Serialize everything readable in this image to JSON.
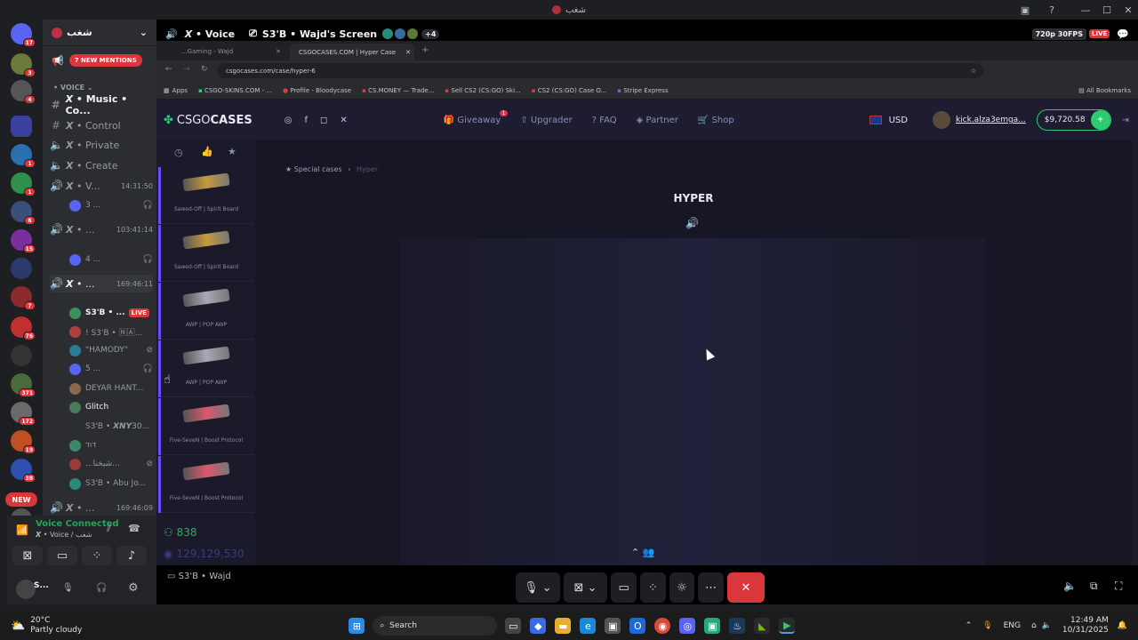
{
  "titlebar": {
    "title": "شغب"
  },
  "server": {
    "name": "شغب",
    "mentions_label": "7 NEW MENTIONS",
    "voice_category": "VOICE"
  },
  "rail_badges": [
    "17",
    "3",
    "4",
    "1",
    "1",
    "6",
    "15",
    "7",
    "76",
    "371",
    "172",
    "19",
    "38",
    "NEW",
    "90"
  ],
  "channels": [
    {
      "name": "𝙓 • Music • Co...",
      "time": ""
    },
    {
      "name": "𝙓 • Control",
      "time": ""
    },
    {
      "name": "𝙓 • Private",
      "time": ""
    },
    {
      "name": "𝙓 • Create",
      "time": ""
    },
    {
      "name": "𝙓 • V...",
      "time": "14:31:50"
    },
    {
      "name": "𝙓 • ...",
      "time": "103:41:14"
    },
    {
      "name": "𝙓 • ...",
      "time": "169:46:11"
    },
    {
      "name": "𝙓 • ...",
      "time": "169:46:09"
    }
  ],
  "voice_sub": [
    {
      "name": "3 ...",
      "row": 0
    },
    {
      "name": "4 ...",
      "row": 1
    }
  ],
  "voice_users": [
    {
      "name": "S3'B • ...",
      "live": "LIVE"
    },
    {
      "name": "! S3'B • 🄽🄰..."
    },
    {
      "name": "\"HAMODY\""
    },
    {
      "name": "5 ..."
    },
    {
      "name": "DEYAR HANT..."
    },
    {
      "name": "Glitch"
    },
    {
      "name": "S3'B • 𝙓𝙉𝙔30..."
    },
    {
      "name": "דוד"
    },
    {
      "name": "...شيخنا..."
    },
    {
      "name": "S3'B • Abu Jo..."
    }
  ],
  "voice_connected": {
    "status": "Voice Connected",
    "channel": "𝙓 • Voice / شغب"
  },
  "user_panel": {
    "name": "S..."
  },
  "stream": {
    "header_channel": "𝙓 • Voice",
    "header_stream": "S3'B • Wajd's Screen",
    "plus_count": "+4",
    "quality": "720p 30FPS",
    "live": "LIVE",
    "bottom_label": "S3'B • Wajd"
  },
  "browser": {
    "url": "csgocases.com/case/hyper-6",
    "tab_active": "CSGOCASES.COM | Hyper Case",
    "tab_other": "...Gaming - Wajd",
    "bookmarks": [
      "Apps",
      "CSGO-SKINS.COM - ...",
      "Profile - Bloodycase",
      "CS.MONEY — Trade...",
      "Sell CS2 (CS:GO) Ski...",
      "CS2 (CS:GO) Case O...",
      "Stripe Express"
    ],
    "all_bookmarks": "All Bookmarks"
  },
  "site": {
    "logo_a": "CSGO",
    "logo_b": "CASES",
    "nav": [
      {
        "label": "Giveaway",
        "badge": "1"
      },
      {
        "label": "Upgrader"
      },
      {
        "label": "FAQ"
      },
      {
        "label": "Partner"
      },
      {
        "label": "Shop"
      }
    ],
    "currency": "USD",
    "username": "kick.alza3emga...",
    "balance": "$9,720.58",
    "breadcrumb_root": "Special cases",
    "breadcrumb_current": "Hyper",
    "case_title": "HYPER",
    "online_count": "838",
    "total_count": "129,129,530"
  },
  "skins": [
    {
      "name": "Sawed-Off | Spirit Board",
      "color": "#c59a3c"
    },
    {
      "name": "Sawed-Off | Spirit Board",
      "color": "#c59a3c"
    },
    {
      "name": "AWP | POP AWP",
      "color": "#a8a8b8"
    },
    {
      "name": "AWP | POP AWP",
      "color": "#a8a8b8"
    },
    {
      "name": "Five-SeveN | Boost Protocol",
      "color": "#d9586b"
    },
    {
      "name": "Five-SeveN | Boost Protocol",
      "color": "#d9586b"
    }
  ],
  "taskbar": {
    "temp": "20°C",
    "weather": "Partly cloudy",
    "search": "Search",
    "lang": "ENG",
    "time": "12:49 AM",
    "date": "10/31/2025"
  },
  "colors": {
    "accent": "#5865f2",
    "live": "#da373c",
    "site_bg": "#1d1c30",
    "balance_green": "#2ecc71"
  }
}
